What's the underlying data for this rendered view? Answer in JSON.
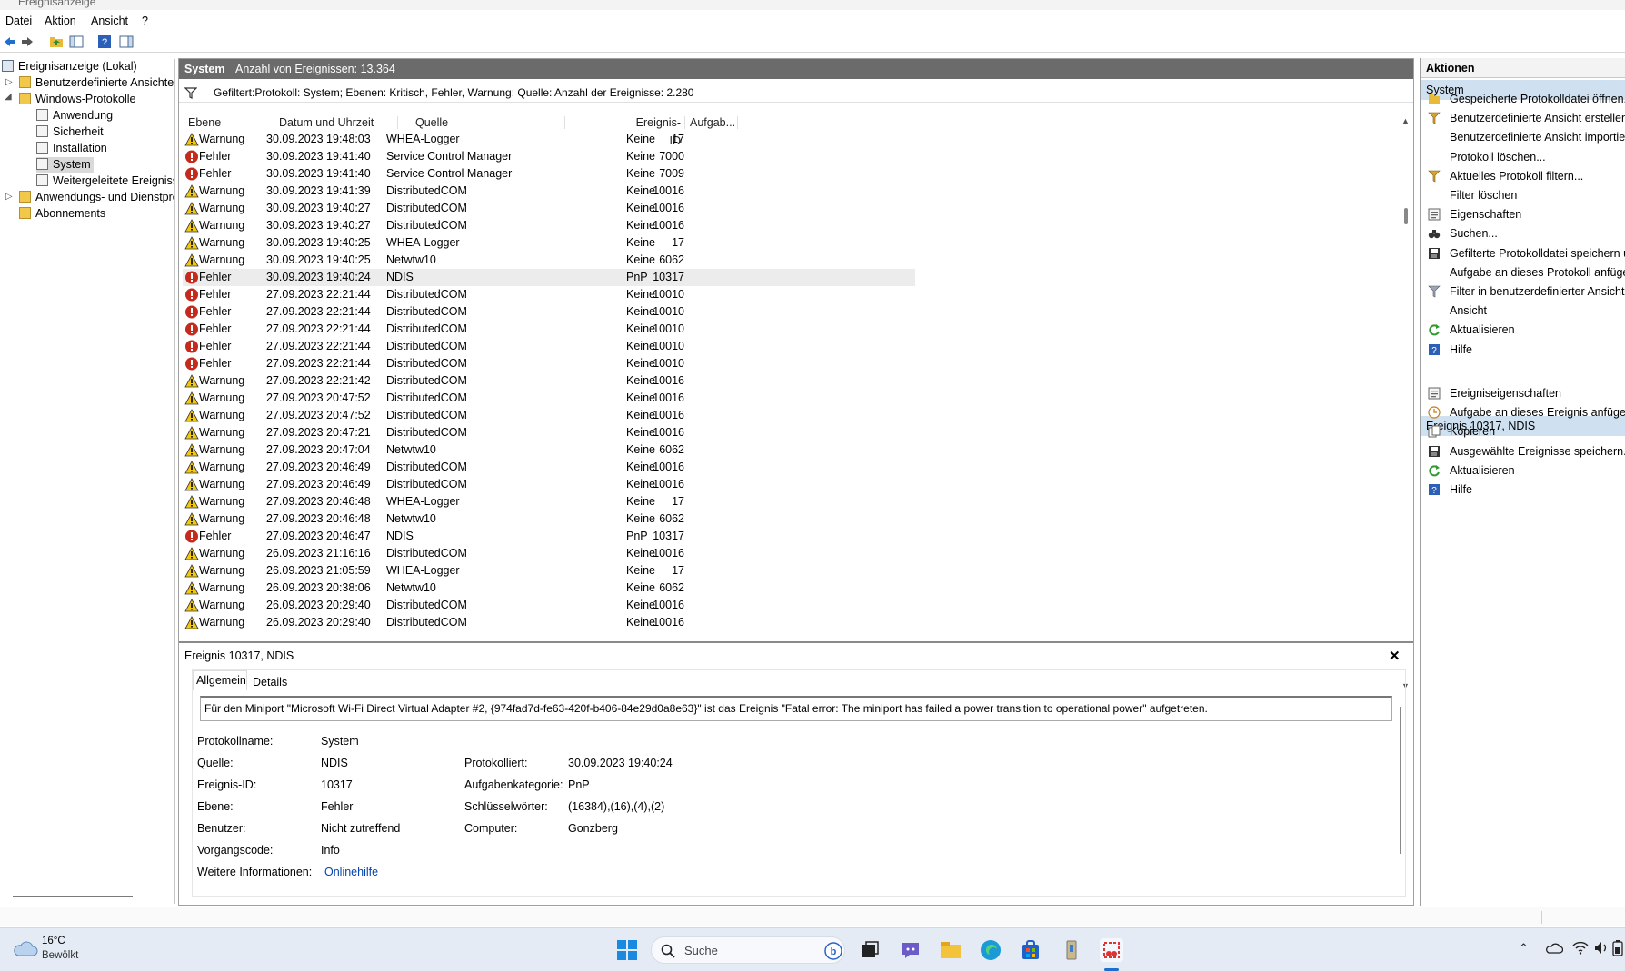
{
  "window": {
    "title": "Ereignisanzeige"
  },
  "menu": {
    "items": [
      "Datei",
      "Aktion",
      "Ansicht",
      "?"
    ]
  },
  "tree": {
    "root": "Ereignisanzeige (Lokal)",
    "items": [
      {
        "label": "Benutzerdefinierte Ansichten"
      },
      {
        "label": "Windows-Protokolle"
      },
      {
        "label": "Anwendung"
      },
      {
        "label": "Sicherheit"
      },
      {
        "label": "Installation"
      },
      {
        "label": "System"
      },
      {
        "label": "Weitergeleitete Ereignisse"
      },
      {
        "label": "Anwendungs- und Dienstprotokolle"
      },
      {
        "label": "Abonnements"
      }
    ]
  },
  "center": {
    "header_title": "System",
    "header_count": "Anzahl von Ereignissen: 13.364",
    "filter_text": "Gefiltert:Protokoll: System; Ebenen: Kritisch, Fehler, Warnung; Quelle:  Anzahl der Ereignisse: 2.280",
    "columns": [
      "Ebene",
      "Datum und Uhrzeit",
      "Quelle",
      "Ereignis-ID",
      "Aufgab..."
    ],
    "rows": [
      {
        "level": "Warnung",
        "date": "30.09.2023 19:48:03",
        "source": "WHEA-Logger",
        "id": "17",
        "task": "Keine"
      },
      {
        "level": "Fehler",
        "date": "30.09.2023 19:41:40",
        "source": "Service Control Manager",
        "id": "7000",
        "task": "Keine"
      },
      {
        "level": "Fehler",
        "date": "30.09.2023 19:41:40",
        "source": "Service Control Manager",
        "id": "7009",
        "task": "Keine"
      },
      {
        "level": "Warnung",
        "date": "30.09.2023 19:41:39",
        "source": "DistributedCOM",
        "id": "10016",
        "task": "Keine"
      },
      {
        "level": "Warnung",
        "date": "30.09.2023 19:40:27",
        "source": "DistributedCOM",
        "id": "10016",
        "task": "Keine"
      },
      {
        "level": "Warnung",
        "date": "30.09.2023 19:40:27",
        "source": "DistributedCOM",
        "id": "10016",
        "task": "Keine"
      },
      {
        "level": "Warnung",
        "date": "30.09.2023 19:40:25",
        "source": "WHEA-Logger",
        "id": "17",
        "task": "Keine"
      },
      {
        "level": "Warnung",
        "date": "30.09.2023 19:40:25",
        "source": "Netwtw10",
        "id": "6062",
        "task": "Keine"
      },
      {
        "level": "Fehler",
        "date": "30.09.2023 19:40:24",
        "source": "NDIS",
        "id": "10317",
        "task": "PnP"
      },
      {
        "level": "Fehler",
        "date": "27.09.2023 22:21:44",
        "source": "DistributedCOM",
        "id": "10010",
        "task": "Keine"
      },
      {
        "level": "Fehler",
        "date": "27.09.2023 22:21:44",
        "source": "DistributedCOM",
        "id": "10010",
        "task": "Keine"
      },
      {
        "level": "Fehler",
        "date": "27.09.2023 22:21:44",
        "source": "DistributedCOM",
        "id": "10010",
        "task": "Keine"
      },
      {
        "level": "Fehler",
        "date": "27.09.2023 22:21:44",
        "source": "DistributedCOM",
        "id": "10010",
        "task": "Keine"
      },
      {
        "level": "Fehler",
        "date": "27.09.2023 22:21:44",
        "source": "DistributedCOM",
        "id": "10010",
        "task": "Keine"
      },
      {
        "level": "Warnung",
        "date": "27.09.2023 22:21:42",
        "source": "DistributedCOM",
        "id": "10016",
        "task": "Keine"
      },
      {
        "level": "Warnung",
        "date": "27.09.2023 20:47:52",
        "source": "DistributedCOM",
        "id": "10016",
        "task": "Keine"
      },
      {
        "level": "Warnung",
        "date": "27.09.2023 20:47:52",
        "source": "DistributedCOM",
        "id": "10016",
        "task": "Keine"
      },
      {
        "level": "Warnung",
        "date": "27.09.2023 20:47:21",
        "source": "DistributedCOM",
        "id": "10016",
        "task": "Keine"
      },
      {
        "level": "Warnung",
        "date": "27.09.2023 20:47:04",
        "source": "Netwtw10",
        "id": "6062",
        "task": "Keine"
      },
      {
        "level": "Warnung",
        "date": "27.09.2023 20:46:49",
        "source": "DistributedCOM",
        "id": "10016",
        "task": "Keine"
      },
      {
        "level": "Warnung",
        "date": "27.09.2023 20:46:49",
        "source": "DistributedCOM",
        "id": "10016",
        "task": "Keine"
      },
      {
        "level": "Warnung",
        "date": "27.09.2023 20:46:48",
        "source": "WHEA-Logger",
        "id": "17",
        "task": "Keine"
      },
      {
        "level": "Warnung",
        "date": "27.09.2023 20:46:48",
        "source": "Netwtw10",
        "id": "6062",
        "task": "Keine"
      },
      {
        "level": "Fehler",
        "date": "27.09.2023 20:46:47",
        "source": "NDIS",
        "id": "10317",
        "task": "PnP"
      },
      {
        "level": "Warnung",
        "date": "26.09.2023 21:16:16",
        "source": "DistributedCOM",
        "id": "10016",
        "task": "Keine"
      },
      {
        "level": "Warnung",
        "date": "26.09.2023 21:05:59",
        "source": "WHEA-Logger",
        "id": "17",
        "task": "Keine"
      },
      {
        "level": "Warnung",
        "date": "26.09.2023 20:38:06",
        "source": "Netwtw10",
        "id": "6062",
        "task": "Keine"
      },
      {
        "level": "Warnung",
        "date": "26.09.2023 20:29:40",
        "source": "DistributedCOM",
        "id": "10016",
        "task": "Keine"
      },
      {
        "level": "Warnung",
        "date": "26.09.2023 20:29:40",
        "source": "DistributedCOM",
        "id": "10016",
        "task": "Keine"
      }
    ],
    "selected_row": 8
  },
  "detail": {
    "title": "Ereignis 10317, NDIS",
    "close": "✕",
    "tabs": [
      "Allgemein",
      "Details"
    ],
    "message": "Für den Miniport \"Microsoft Wi-Fi Direct Virtual Adapter #2, {974fad7d-fe63-420f-b406-84e29d0a8e63}\" ist das Ereignis \"Fatal error: The miniport has failed a power transition to operational power\" aufgetreten.",
    "protokollname_label": "Protokollname:",
    "protokollname": "System",
    "quelle_label": "Quelle:",
    "quelle": "NDIS",
    "protokolliert_label": "Protokolliert:",
    "protokolliert": "30.09.2023 19:40:24",
    "eid_label": "Ereignis-ID:",
    "eid": "10317",
    "kat_label": "Aufgabenkategorie:",
    "kat": "PnP",
    "ebene_label": "Ebene:",
    "ebene": "Fehler",
    "keys_label": "Schlüsselwörter:",
    "keys": "(16384),(16),(4),(2)",
    "benutzer_label": "Benutzer:",
    "benutzer": "Nicht zutreffend",
    "computer_label": "Computer:",
    "computer": "Gonzberg",
    "vorgang_label": "Vorgangscode:",
    "vorgang": "Info",
    "weitere_label": "Weitere Informationen:",
    "weitere_link": "Onlinehilfe"
  },
  "actions": {
    "title": "Aktionen",
    "section1": "System",
    "items1": [
      {
        "label": "Gespeicherte Protokolldatei öffnen...",
        "icon": "folder-open-icon"
      },
      {
        "label": "Benutzerdefinierte Ansicht erstellen...",
        "icon": "filter-icon"
      },
      {
        "label": "Benutzerdefinierte Ansicht importieren...",
        "icon": "none"
      },
      {
        "label": "Protokoll löschen...",
        "icon": "none"
      },
      {
        "label": "Aktuelles Protokoll filtern...",
        "icon": "filter-icon"
      },
      {
        "label": "Filter löschen",
        "icon": "none"
      },
      {
        "label": "Eigenschaften",
        "icon": "properties-icon"
      },
      {
        "label": "Suchen...",
        "icon": "binoculars-icon"
      },
      {
        "label": "Gefilterte Protokolldatei speichern unter...",
        "icon": "save-icon"
      },
      {
        "label": "Aufgabe an dieses Protokoll anfügen...",
        "icon": "none"
      },
      {
        "label": "Filter in benutzerdefinierter Ansicht speichern...",
        "icon": "filter-save-icon"
      },
      {
        "label": "Ansicht",
        "icon": "none"
      },
      {
        "label": "Aktualisieren",
        "icon": "refresh-icon"
      },
      {
        "label": "Hilfe",
        "icon": "help-icon"
      }
    ],
    "section2": "Ereignis 10317, NDIS",
    "items2": [
      {
        "label": "Ereigniseigenschaften",
        "icon": "properties-icon"
      },
      {
        "label": "Aufgabe an dieses Ereignis anfügen...",
        "icon": "task-icon"
      },
      {
        "label": "Kopieren",
        "icon": "copy-icon"
      },
      {
        "label": "Ausgewählte Ereignisse speichern...",
        "icon": "save-icon"
      },
      {
        "label": "Aktualisieren",
        "icon": "refresh-icon"
      },
      {
        "label": "Hilfe",
        "icon": "help-icon"
      }
    ]
  },
  "taskbar": {
    "temp": "16°C",
    "weather": "Bewölkt",
    "search": "Suche"
  },
  "colors": {
    "error": "#c42b1c",
    "warning": "#f2c811",
    "header": "#6b6b6b",
    "action_section": "#cfe0f1",
    "taskbar": "#e4ebf4"
  }
}
